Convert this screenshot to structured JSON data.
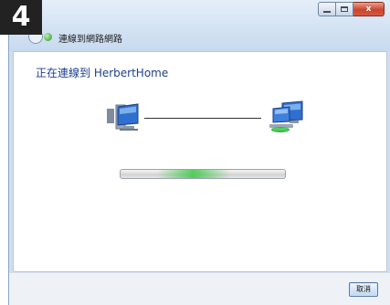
{
  "step_badge": "4",
  "window": {
    "title": "連線到網路網路",
    "caption": {
      "close_label": "x"
    }
  },
  "main": {
    "heading": "正在連線到 HerbertHome",
    "progress": {
      "mode": "indeterminate",
      "color": "#3cc846"
    }
  },
  "footer": {
    "cancel_label": "取消"
  },
  "icons": {
    "back": "back-arrow-icon",
    "network": "network-status-icon",
    "computer": "computer-icon",
    "network_target": "networked-computers-icon"
  },
  "colors": {
    "heading": "#1d3f8c",
    "titlebar": "#d2e2f3",
    "close_button": "#c9452e"
  }
}
